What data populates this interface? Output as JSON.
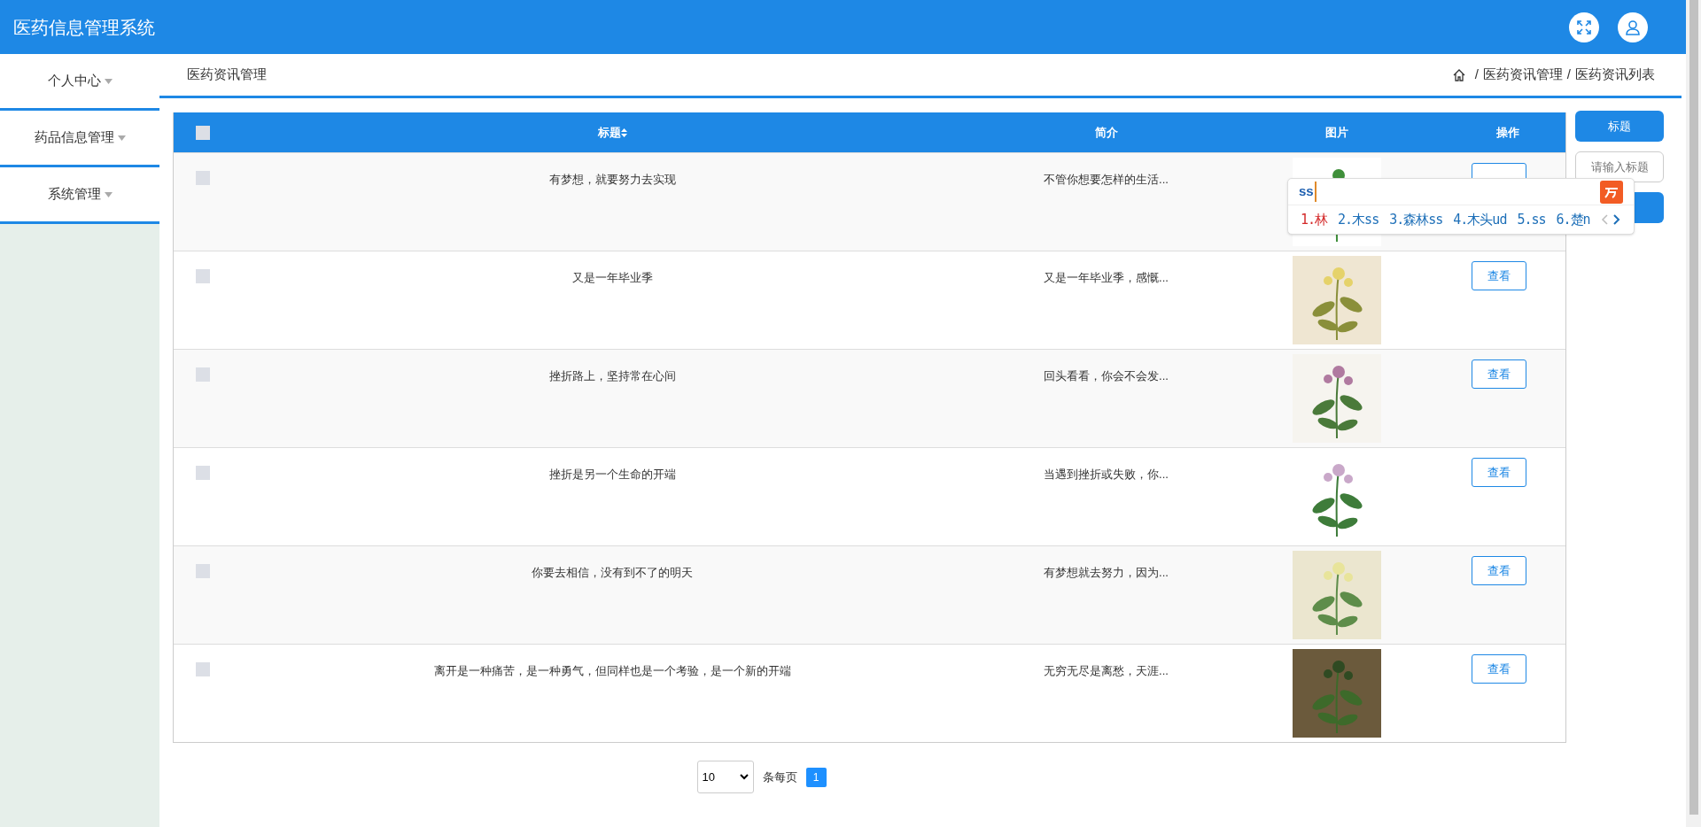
{
  "header": {
    "title": "医药信息管理系统"
  },
  "sidebar": {
    "items": [
      {
        "label": "个人中心",
        "expanded": false
      },
      {
        "label": "药品信息管理",
        "expanded": false
      },
      {
        "label": "系统管理",
        "expanded": false
      }
    ]
  },
  "page": {
    "title": "医药资讯管理",
    "breadcrumb": [
      {
        "separator": "/",
        "label": "医药资讯管理"
      },
      {
        "separator": "/",
        "label": "医药资讯列表"
      }
    ]
  },
  "table": {
    "all_checked": false,
    "columns": [
      "标题",
      "简介",
      "图片",
      "操作"
    ],
    "rows": [
      {
        "checked": false,
        "title": "有梦想，就要努力去实现",
        "intro": "不管你想要怎样的生活..."
      },
      {
        "checked": false,
        "title": "又是一年毕业季",
        "intro": "又是一年毕业季，感慨...",
        "action": "查看"
      },
      {
        "checked": false,
        "title": "挫折路上，坚持常在心间",
        "intro": "回头看看，你会不会发...",
        "action": "查看"
      },
      {
        "checked": false,
        "title": "挫折是另一个生命的开端",
        "intro": "当遇到挫折或失败，你...",
        "action": "查看"
      },
      {
        "checked": false,
        "title": "你要去相信，没有到不了的明天",
        "intro": "有梦想就去努力，因为...",
        "action": "查看"
      },
      {
        "checked": false,
        "title": "离开是一种痛苦，是一种勇气，但同样也是一个考验，是一个新的开端",
        "intro": "无穷无尽是离愁，天涯...",
        "action": "查看"
      }
    ]
  },
  "search": {
    "label": "标题",
    "placeholder": "请输入标题"
  },
  "pagination": {
    "page_size": "10",
    "per_page_label": "条每页",
    "pages": [
      {
        "label": "1",
        "selected": true
      }
    ]
  },
  "ime": {
    "input": "ss",
    "candidates": [
      {
        "label": "1.林",
        "selected": true
      },
      {
        "label": "2.木ss",
        "selected": false
      },
      {
        "label": "3.森林ss",
        "selected": false
      },
      {
        "label": "4.木头ud",
        "selected": false
      },
      {
        "label": "5.ss",
        "selected": false
      },
      {
        "label": "6.楚n",
        "selected": false
      }
    ]
  }
}
